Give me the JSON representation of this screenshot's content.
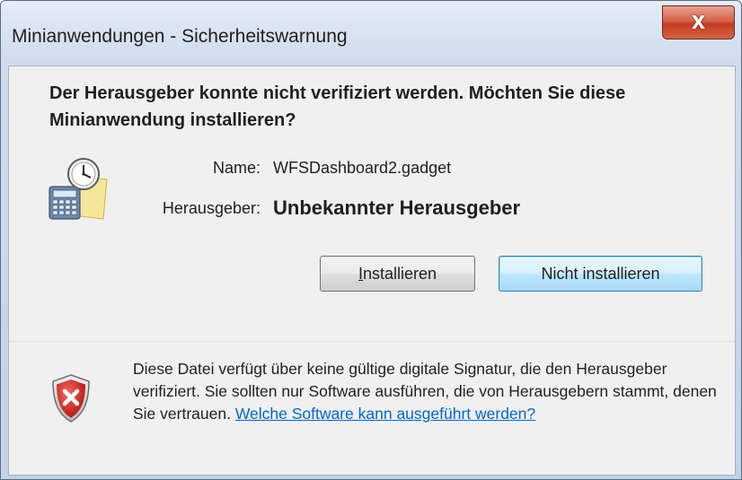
{
  "window": {
    "title": "Minianwendungen - Sicherheitswarnung",
    "close_label": "X"
  },
  "header": {
    "heading": "Der Herausgeber konnte nicht verifiziert werden. Möchten Sie diese Minianwendung installieren?"
  },
  "details": {
    "name_label": "Name:",
    "name_value": "WFSDashboard2.gadget",
    "publisher_label": "Herausgeber:",
    "publisher_value": "Unbekannter Herausgeber"
  },
  "buttons": {
    "install_prefix": "",
    "install_mnemonic": "I",
    "install_rest": "nstallieren",
    "no_install": "Nicht installieren"
  },
  "footer": {
    "warning_text": "Diese Datei verfügt über keine gültige digitale Signatur, die den Herausgeber verifiziert. Sie sollten nur Software ausführen, die von Herausgebern stammt, denen Sie vertrauen. ",
    "link_text": "Welche Software kann ausgeführt werden?"
  },
  "icons": {
    "gadget": "gadget-calendar-clock-icon",
    "shield": "security-shield-x-icon"
  },
  "colors": {
    "link": "#0066cc",
    "close_button": "#c23b21",
    "shield": "#c8201b"
  }
}
